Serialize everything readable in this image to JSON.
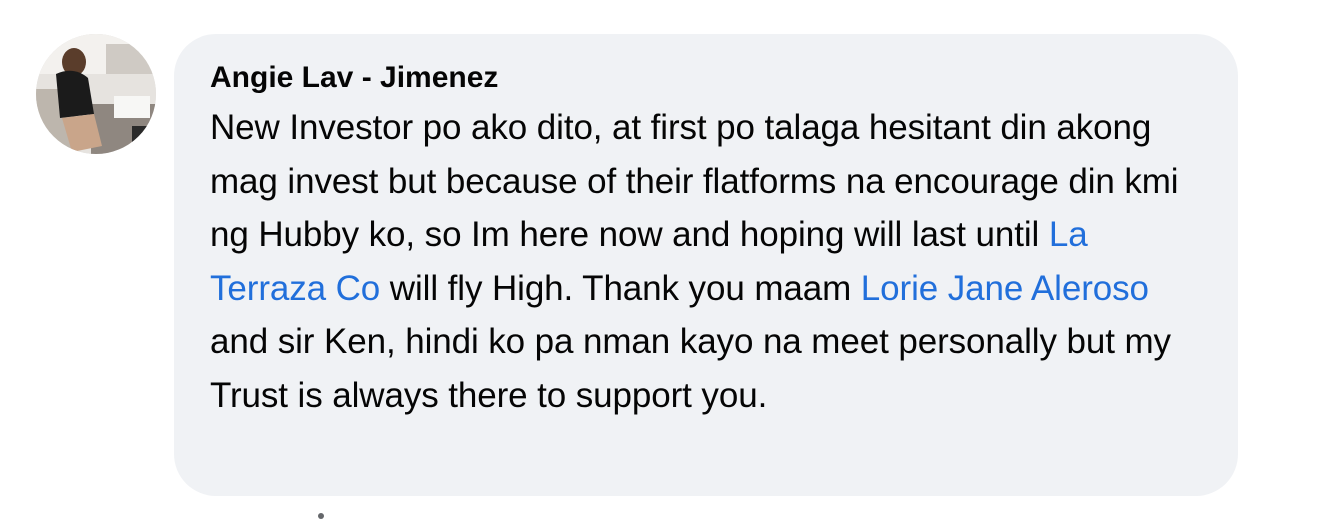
{
  "comment": {
    "author": "Angie Lav - Jimenez",
    "text": {
      "part1": "New Investor po ako dito, at first po talaga hesitant din akong mag invest but because of their flatforms na encourage din kmi ng Hubby ko, so Im here now and hoping will last until ",
      "mention1": "La Terraza Co",
      "part2": " will fly High. Thank you maam ",
      "mention2": "Lorie Jane Aleroso",
      "part3": " and sir Ken, hindi ko pa nman kayo na meet personally but my Trust is always there to support you."
    }
  },
  "colors": {
    "bubble_bg": "#f0f2f5",
    "mention": "#216fdb",
    "text": "#050505"
  },
  "icons": {
    "avatar": "user-profile-photo"
  }
}
